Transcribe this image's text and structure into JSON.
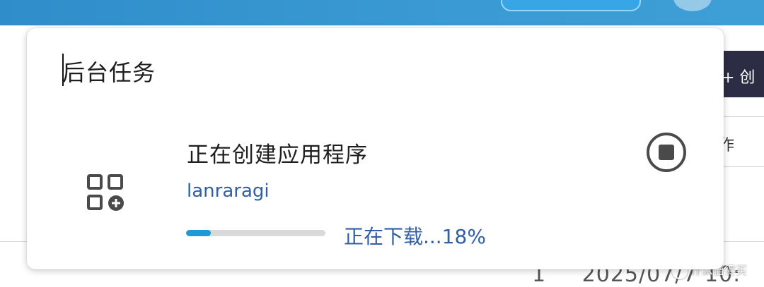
{
  "background": {
    "header_color": "#3a9ad3",
    "dark_bar_text": "+ 创",
    "column_text": "作",
    "bottom_row_count": "1",
    "bottom_row_date": "2025/07/7 10:",
    "watermark": "什么值得买"
  },
  "panel": {
    "title": "后台任务",
    "tasks": [
      {
        "icon": "apps-add-icon",
        "title": "正在创建应用程序",
        "app_name": "lanraragi",
        "progress_text": "正在下载...18%",
        "progress_fraction": 0.18,
        "stop_icon": "stop-circle-icon"
      }
    ]
  },
  "colors": {
    "accent": "#1e9ad6",
    "link_text": "#2f5fa8",
    "track": "#d9d9d9"
  }
}
